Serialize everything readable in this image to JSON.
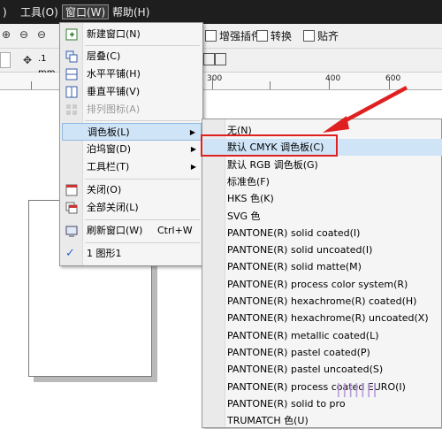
{
  "menubar": {
    "items": [
      {
        "label": ")"
      },
      {
        "label": "工具(O)"
      },
      {
        "label": "窗口(W)"
      },
      {
        "label": "帮助(H)"
      }
    ]
  },
  "toolbar1": {
    "buttons": [
      {
        "label": "增强插件"
      },
      {
        "label": "转换"
      },
      {
        "label": "贴齐"
      }
    ]
  },
  "toolbar2": {
    "nudge_value": ".1 mm"
  },
  "ruler": {
    "labels": [
      "300",
      "400",
      "600"
    ]
  },
  "window_menu": {
    "items": [
      {
        "label": "新建窗口(N)",
        "icon": "new-window-icon"
      },
      {
        "label": "层叠(C)",
        "icon": "cascade-icon"
      },
      {
        "label": "水平平铺(H)",
        "icon": "tile-horizontal-icon"
      },
      {
        "label": "垂直平铺(V)",
        "icon": "tile-vertical-icon"
      },
      {
        "label": "排列图标(A)",
        "icon": "arrange-icons-icon",
        "disabled": true
      },
      {
        "label": "调色板(L)",
        "submenu": true,
        "highlighted": true
      },
      {
        "label": "泊坞窗(D)",
        "submenu": true
      },
      {
        "label": "工具栏(T)",
        "submenu": true
      },
      {
        "label": "关闭(O)",
        "icon": "close-window-icon"
      },
      {
        "label": "全部关闭(L)",
        "icon": "close-all-icon"
      },
      {
        "label": "刷新窗口(W)",
        "shortcut": "Ctrl+W",
        "icon": "refresh-window-icon"
      },
      {
        "label": "1 图形1",
        "checked": true
      }
    ]
  },
  "palette_submenu": {
    "items": [
      "无(N)",
      "默认 CMYK 调色板(C)",
      "默认 RGB 调色板(G)",
      "标准色(F)",
      "HKS 色(K)",
      "SVG 色",
      "PANTONE(R) solid coated(I)",
      "PANTONE(R) solid uncoated(I)",
      "PANTONE(R) solid matte(M)",
      "PANTONE(R) process color system(R)",
      "PANTONE(R) hexachrome(R) coated(H)",
      "PANTONE(R) hexachrome(R) uncoated(X)",
      "PANTONE(R) metallic coated(L)",
      "PANTONE(R) pastel coated(P)",
      "PANTONE(R) pastel uncoated(S)",
      "PANTONE(R) process coated EURO(I)",
      "PANTONE(R) solid to pro",
      "TRUMATCH 色(U)"
    ],
    "highlighted_index": 1
  },
  "colors": {
    "highlight": "#cfe4f7",
    "annotation": "#e02020",
    "menubar": "#1e1e1e"
  }
}
